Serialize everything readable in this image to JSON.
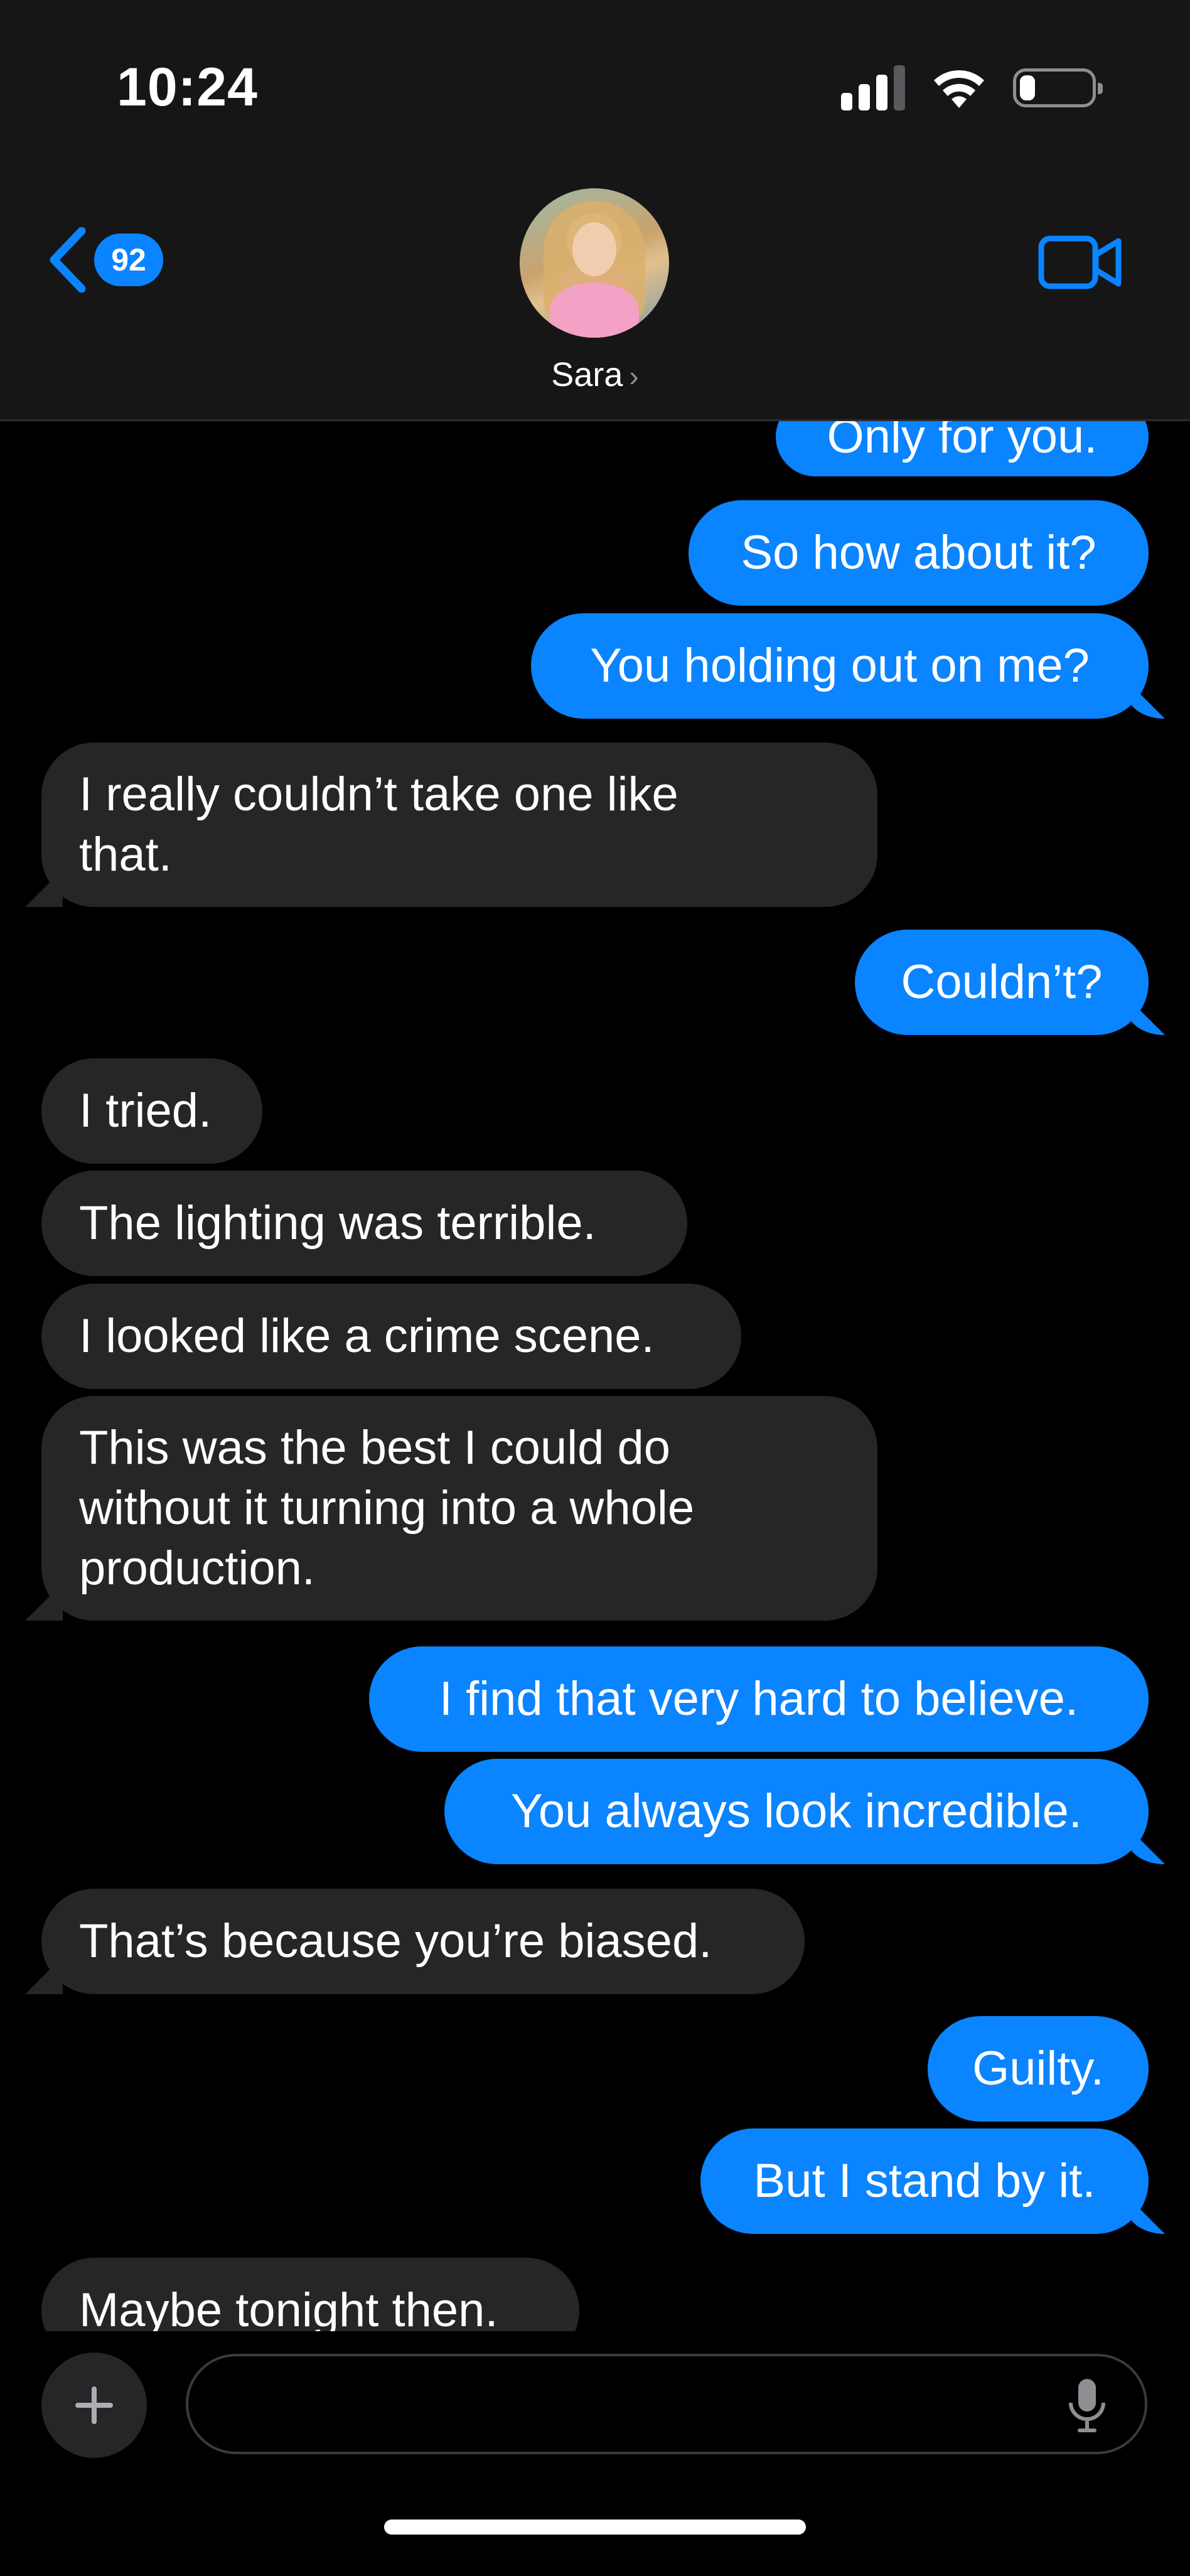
{
  "status": {
    "time": "10:24",
    "battery_level": 0.2
  },
  "header": {
    "back_badge": "92",
    "contact_name": "Sara",
    "contact_chevron": "›"
  },
  "messages": [
    {
      "dir": "out",
      "text": "Only for you."
    },
    {
      "dir": "out",
      "text": "So how about it?"
    },
    {
      "dir": "out",
      "text": "You holding out on me?"
    },
    {
      "dir": "in",
      "text": "I really couldn’t take one like\nthat."
    },
    {
      "dir": "out",
      "text": "Couldn’t?"
    },
    {
      "dir": "in",
      "text": "I tried."
    },
    {
      "dir": "in",
      "text": "The lighting was terrible."
    },
    {
      "dir": "in",
      "text": "I looked like a crime scene."
    },
    {
      "dir": "in",
      "text": "This was the best I could do\nwithout it turning into a whole\nproduction."
    },
    {
      "dir": "out",
      "text": "I find that very hard to believe."
    },
    {
      "dir": "out",
      "text": "You always look incredible."
    },
    {
      "dir": "in",
      "text": "That’s because you’re biased."
    },
    {
      "dir": "out",
      "text": "Guilty."
    },
    {
      "dir": "out",
      "text": "But I stand by it."
    },
    {
      "dir": "in",
      "text": "Maybe tonight then."
    }
  ],
  "composer": {
    "placeholder": "",
    "value": ""
  },
  "colors": {
    "outgoing": "#0a84ff",
    "incoming": "#262628",
    "background": "#000000",
    "header": "#161616"
  },
  "icons": [
    "back-chevron-icon",
    "video-camera-icon",
    "signal-icon",
    "wifi-icon",
    "battery-icon",
    "plus-icon",
    "microphone-icon"
  ]
}
